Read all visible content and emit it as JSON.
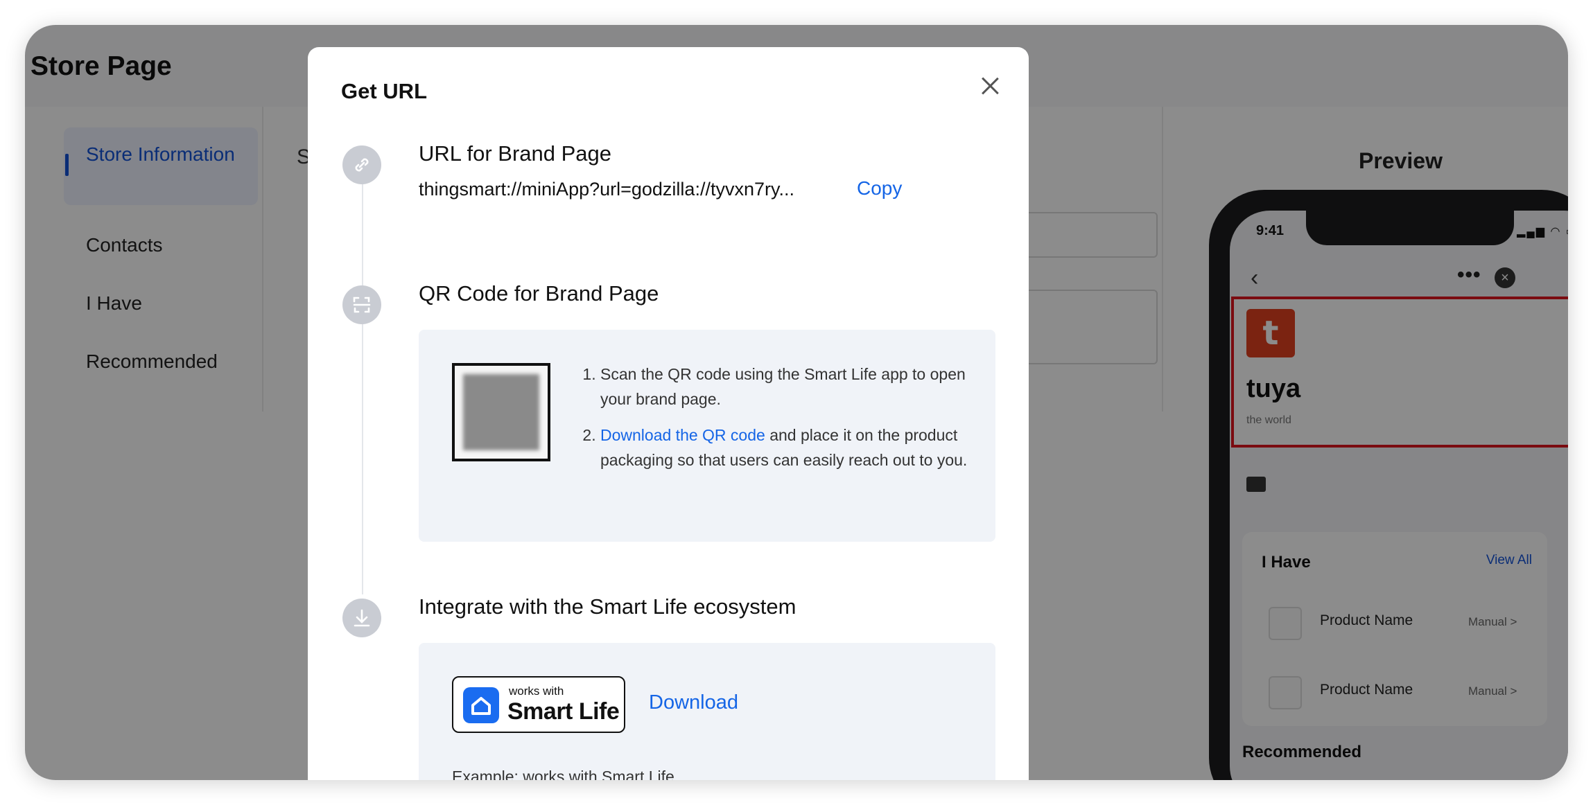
{
  "background_page": {
    "title": "Store Page",
    "menu": [
      {
        "label": "Store Information"
      },
      {
        "label": "Contacts"
      },
      {
        "label": "I Have"
      },
      {
        "label": "Recommended"
      }
    ],
    "form_initial": "S",
    "preview_title": "Preview"
  },
  "phone": {
    "time": "9:41",
    "brand_name": "tuya",
    "brand_tagline": "the world",
    "ihave_title": "I Have",
    "view_all": "View All",
    "products": [
      {
        "name": "Product Name",
        "tag": "Manual"
      },
      {
        "name": "Product Name",
        "tag": "Manual"
      }
    ],
    "recommended_title": "Recommended"
  },
  "modal": {
    "title": "Get URL",
    "steps": [
      {
        "title": "URL for Brand Page",
        "icon": "link-icon"
      },
      {
        "title": "QR Code for Brand Page",
        "icon": "scan-icon"
      },
      {
        "title": "Integrate with the Smart Life ecosystem",
        "icon": "download-icon"
      }
    ],
    "url": "thingsmart://miniApp?url=godzilla://tyvxn7ry...",
    "copy_label": "Copy",
    "qr_instructions": {
      "item1": "Scan the QR code using the Smart Life app to open your brand page.",
      "item2_link": "Download the QR code",
      "item2_rest": " and place it on the product packaging so that users can easily reach out to you."
    },
    "badge": {
      "small": "works with",
      "big": "Smart Life"
    },
    "download_label": "Download",
    "example": "Example: works with Smart Life"
  },
  "colors": {
    "accent": "#1565e6",
    "brand_logo": "#e1401f",
    "highlight_border": "#e0141e"
  }
}
